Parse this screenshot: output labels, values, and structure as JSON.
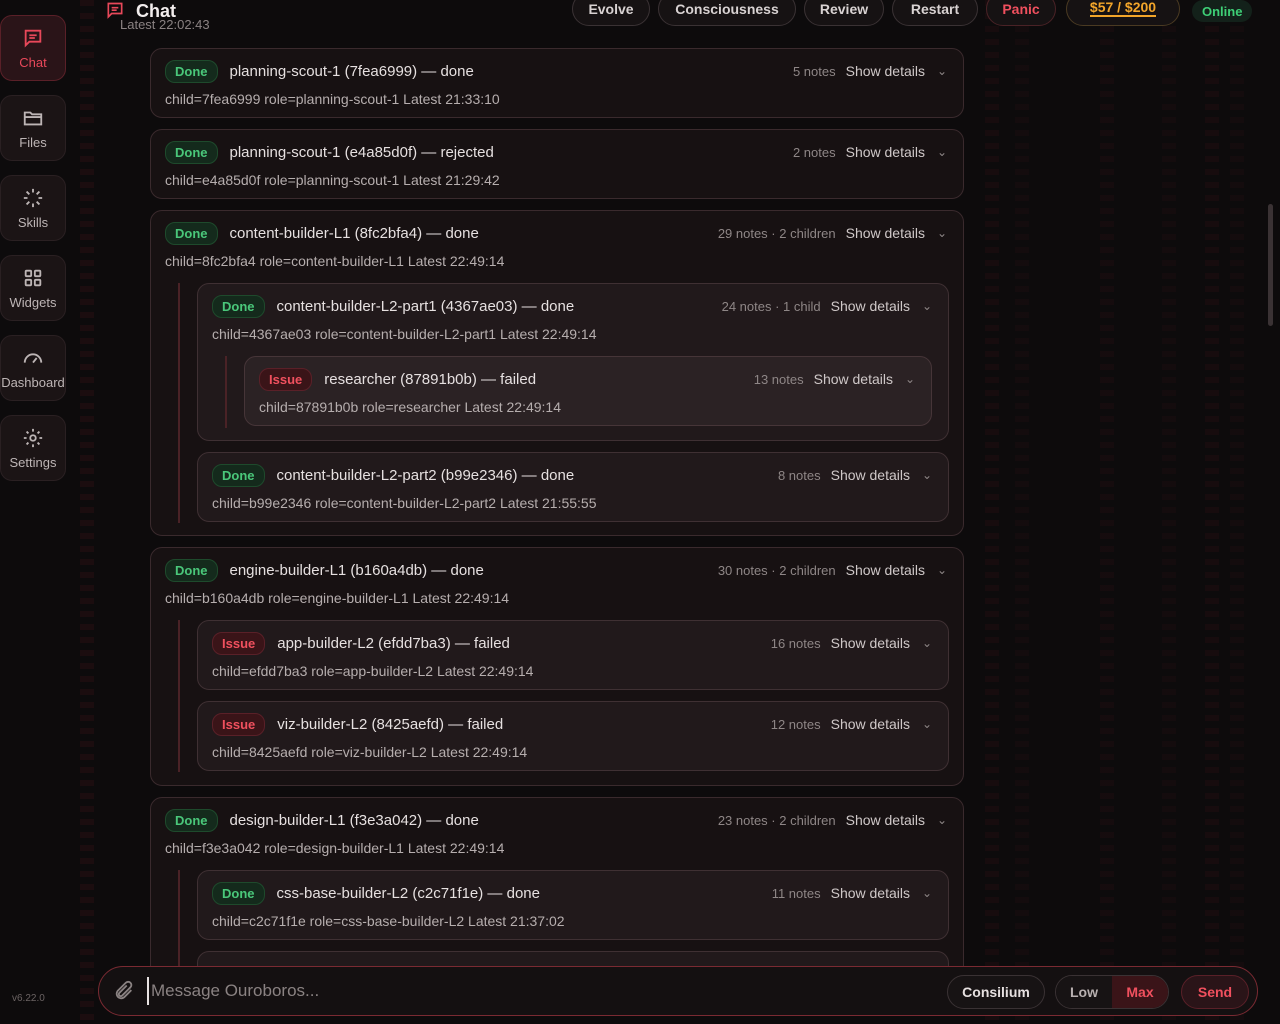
{
  "header": {
    "title": "Chat",
    "subtitle": "Latest 22:02:43",
    "buttons": {
      "evolve": "Evolve",
      "consciousness": "Consciousness",
      "review": "Review",
      "restart": "Restart",
      "panic": "Panic",
      "budget": "$57 / $200"
    },
    "status": "Online"
  },
  "sidebar": {
    "items": [
      {
        "label": "Chat",
        "icon": "chat-icon"
      },
      {
        "label": "Files",
        "icon": "folder-icon"
      },
      {
        "label": "Skills",
        "icon": "spinner-icon"
      },
      {
        "label": "Widgets",
        "icon": "grid-icon"
      },
      {
        "label": "Dashboard",
        "icon": "gauge-icon"
      },
      {
        "label": "Settings",
        "icon": "gear-icon"
      }
    ],
    "version": "v6.22.0"
  },
  "tasks": [
    {
      "status": "Done",
      "title": "planning-scout-1 (7fea6999) — done",
      "notes": "5 notes",
      "details": "Show details",
      "meta": "child=7fea6999  role=planning-scout-1  Latest 21:33:10"
    },
    {
      "status": "Done",
      "title": "planning-scout-1 (e4a85d0f) — rejected",
      "notes": "2 notes",
      "details": "Show details",
      "meta": "child=e4a85d0f  role=planning-scout-1  Latest 21:29:42"
    },
    {
      "status": "Done",
      "title": "content-builder-L1 (8fc2bfa4) — done",
      "notes": "29 notes · 2 children",
      "details": "Show details",
      "meta": "child=8fc2bfa4  role=content-builder-L1  Latest 22:49:14"
    },
    {
      "status": "Done",
      "title": "content-builder-L2-part1 (4367ae03) — done",
      "notes": "24 notes · 1 child",
      "details": "Show details",
      "meta": "child=4367ae03  role=content-builder-L2-part1  Latest 22:49:14"
    },
    {
      "status": "Issue",
      "title": "researcher (87891b0b) — failed",
      "notes": "13 notes",
      "details": "Show details",
      "meta": "child=87891b0b  role=researcher  Latest 22:49:14"
    },
    {
      "status": "Done",
      "title": "content-builder-L2-part2 (b99e2346) — done",
      "notes": "8 notes",
      "details": "Show details",
      "meta": "child=b99e2346  role=content-builder-L2-part2  Latest 21:55:55"
    },
    {
      "status": "Done",
      "title": "engine-builder-L1 (b160a4db) — done",
      "notes": "30 notes · 2 children",
      "details": "Show details",
      "meta": "child=b160a4db  role=engine-builder-L1  Latest 22:49:14"
    },
    {
      "status": "Issue",
      "title": "app-builder-L2 (efdd7ba3) — failed",
      "notes": "16 notes",
      "details": "Show details",
      "meta": "child=efdd7ba3  role=app-builder-L2  Latest 22:49:14"
    },
    {
      "status": "Issue",
      "title": "viz-builder-L2 (8425aefd) — failed",
      "notes": "12 notes",
      "details": "Show details",
      "meta": "child=8425aefd  role=viz-builder-L2  Latest 22:49:14"
    },
    {
      "status": "Done",
      "title": "design-builder-L1 (f3e3a042) — done",
      "notes": "23 notes · 2 children",
      "details": "Show details",
      "meta": "child=f3e3a042  role=design-builder-L1  Latest 22:49:14"
    },
    {
      "status": "Done",
      "title": "css-base-builder-L2 (c2c71f1e) — done",
      "notes": "11 notes",
      "details": "Show details",
      "meta": "child=c2c71f1e  role=css-base-builder-L2  Latest 21:37:02"
    }
  ],
  "composer": {
    "placeholder": "Message Ouroboros...",
    "consilium": "Consilium",
    "low": "Low",
    "max": "Max",
    "send": "Send"
  },
  "colors": {
    "accent": "#e8485a",
    "done": "#4ac77a",
    "issue": "#f0505e",
    "budget": "#f2a52a",
    "online": "#3ecf76"
  }
}
